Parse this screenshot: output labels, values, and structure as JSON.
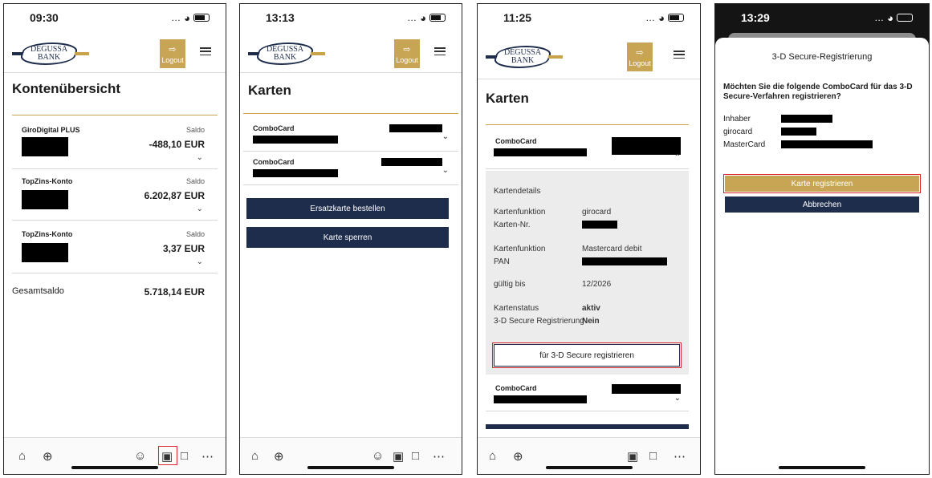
{
  "brand": {
    "logo_text": "DEGUSSA BANK",
    "gold": "#c7a555",
    "navy": "#1f2d4d",
    "highlight": "#d9262c"
  },
  "icons": {
    "signal": "…",
    "wifi": "wifi-icon",
    "battery": "battery-icon"
  },
  "screen1": {
    "time": "09:30",
    "logout_label": "Logout",
    "title": "Kontenübersicht",
    "accounts": [
      {
        "name": "GiroDigital PLUS",
        "saldo_label": "Saldo",
        "amount": "-488,10 EUR"
      },
      {
        "name": "TopZins-Konto",
        "saldo_label": "Saldo",
        "amount": "6.202,87 EUR"
      },
      {
        "name": "TopZins-Konto",
        "saldo_label": "Saldo",
        "amount": "3,37 EUR"
      }
    ],
    "total_label": "Gesamtsaldo",
    "total_value": "5.718,14 EUR"
  },
  "screen2": {
    "time": "13:13",
    "logout_label": "Logout",
    "title": "Karten",
    "cards": [
      {
        "name": "ComboCard"
      },
      {
        "name": "ComboCard"
      }
    ],
    "button_replacement": "Ersatzkarte bestellen",
    "button_block": "Karte sperren"
  },
  "screen3": {
    "time": "11:25",
    "logout_label": "Logout",
    "title": "Karten",
    "card_name": "ComboCard",
    "details_title": "Kartendetails",
    "rows": [
      {
        "label": "Kartenfunktion",
        "value": "girocard"
      },
      {
        "label": "Karten-Nr.",
        "value": ""
      },
      {
        "label": "Kartenfunktion",
        "value": "Mastercard debit"
      },
      {
        "label": "PAN",
        "value": ""
      },
      {
        "label": "gültig bis",
        "value": "12/2026"
      },
      {
        "label": "Kartenstatus",
        "value": "aktiv"
      },
      {
        "label": "3-D Secure Registrierung",
        "value": "Nein"
      }
    ],
    "register_button": "für 3-D Secure registrieren",
    "card2_name": "ComboCard"
  },
  "screen4": {
    "time": "13:29",
    "title": "3-D Secure-Registrierung",
    "question": "Möchten Sie die folgende ComboCard für das 3-D Secure-Verfahren registrieren?",
    "rows": [
      {
        "label": "Inhaber"
      },
      {
        "label": "girocard"
      },
      {
        "label": "MasterCard"
      }
    ],
    "confirm_button": "Karte registrieren",
    "cancel_button": "Abbrechen"
  }
}
